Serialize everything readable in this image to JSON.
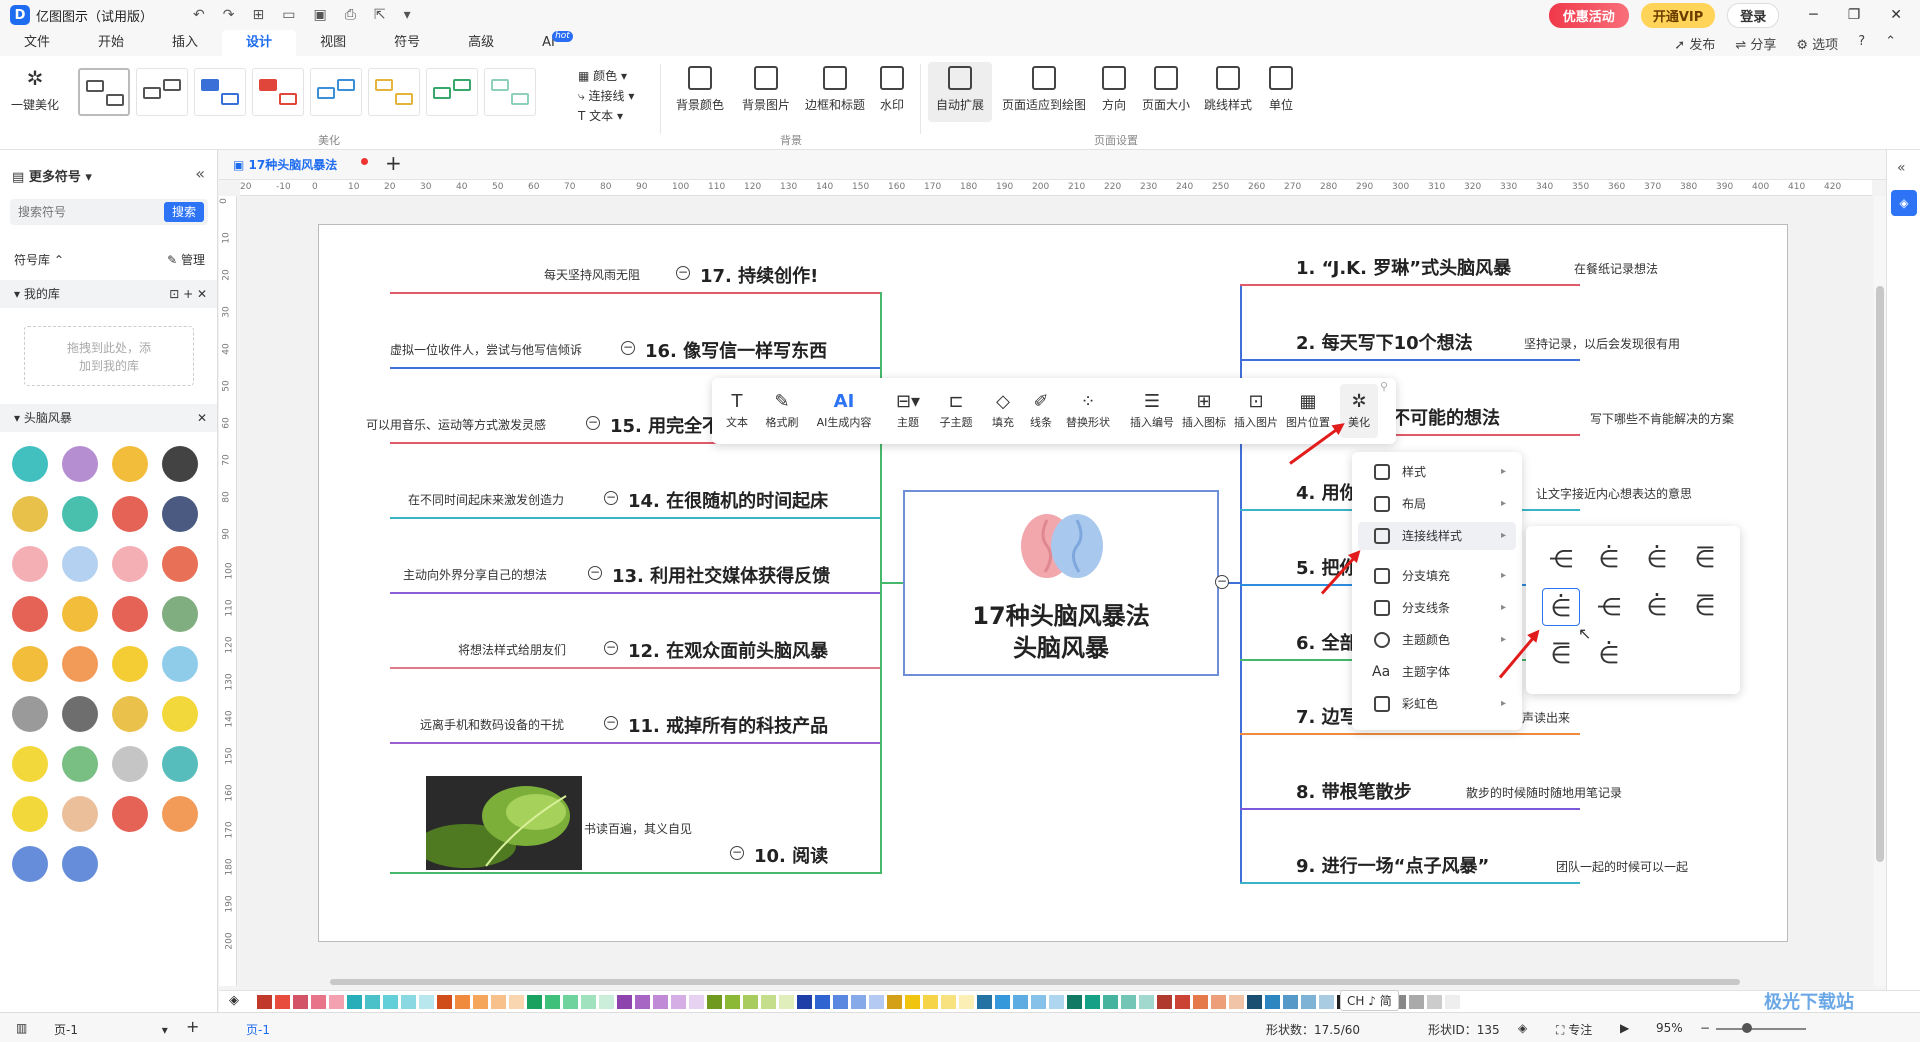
{
  "titlebar": {
    "app_title": "亿图图示（试用版）",
    "logo_letter": "D",
    "promo": "优惠活动",
    "vip": "开通VIP",
    "login": "登录"
  },
  "menubar": {
    "items": [
      "文件",
      "开始",
      "插入",
      "设计",
      "视图",
      "符号",
      "高级",
      "AI"
    ],
    "active": "设计",
    "ai_badge": "hot",
    "right": [
      "发布",
      "分享",
      "选项"
    ]
  },
  "ribbon": {
    "beautify_button": "一键美化",
    "group_beautify": "美化",
    "color_option": "颜色",
    "connector_option": "连接线",
    "text_option": "文本",
    "background_buttons": [
      "背景颜色",
      "背景图片",
      "边框和标题",
      "水印"
    ],
    "group_background": "背景",
    "page_buttons": [
      "自动扩展",
      "页面适应到绘图",
      "方向",
      "页面大小",
      "跳线样式",
      "单位"
    ],
    "group_page": "页面设置"
  },
  "leftpanel": {
    "title": "更多符号",
    "search_placeholder": "搜索符号",
    "search_button": "搜索",
    "library_label": "符号库",
    "manage": "管理",
    "my_library": "我的库",
    "drop_hint_1": "拖拽到此处，添",
    "drop_hint_2": "加到我的库",
    "category": "头脑风暴"
  },
  "tab": {
    "name": "17种头脑风暴法"
  },
  "ruler": {
    "h_ticks": [
      "20",
      "-10",
      "0",
      "10",
      "20",
      "30",
      "40",
      "50",
      "60",
      "70",
      "80",
      "90",
      "100",
      "110",
      "120",
      "130",
      "140",
      "150",
      "160",
      "170",
      "180",
      "190",
      "200",
      "210",
      "220",
      "230",
      "240",
      "250",
      "260",
      "270",
      "280",
      "290",
      "300",
      "310",
      "320",
      "330",
      "340",
      "350",
      "360",
      "370",
      "380",
      "390",
      "400",
      "410",
      "420"
    ],
    "v_ticks": [
      "0",
      "10",
      "20",
      "30",
      "40",
      "50",
      "60",
      "70",
      "80",
      "90",
      "100",
      "110",
      "120",
      "130",
      "140",
      "150",
      "160",
      "170",
      "180",
      "190",
      "200"
    ]
  },
  "mindmap": {
    "center_line1": "17种头脑风暴法",
    "center_line2": "头脑风暴",
    "left": [
      {
        "title": "17. 持续创作!",
        "note": "每天坚持风雨无阻",
        "color": "#e05a6b"
      },
      {
        "title": "16. 像写信一样写东西",
        "note": "虚拟一位收件人，尝试与他写信倾诉",
        "color": "#3f6fd8"
      },
      {
        "title": "15. 用完全不",
        "note": "可以用音乐、运动等方式激发灵感",
        "color": "#e05a6b"
      },
      {
        "title": "14. 在很随机的时间起床",
        "note": "在不同时间起床来激发创造力",
        "color": "#39b4c7"
      },
      {
        "title": "13. 利用社交媒体获得反馈",
        "note": "主动向外界分享自己的想法",
        "color": "#8a5ed6"
      },
      {
        "title": "12. 在观众面前头脑风暴",
        "note": "将想法样式给朋友们",
        "color": "#e07a8a"
      },
      {
        "title": "11. 戒掉所有的科技产品",
        "note": "远离手机和数码设备的干扰",
        "color": "#9b5fd0"
      },
      {
        "title": "10. 阅读",
        "note": "书读百遍，其义自见",
        "color": "#45b86b"
      }
    ],
    "right": [
      {
        "title": "1. “J.K. 罗琳”式头脑风暴",
        "note": "在餐纸记录想法",
        "color": "#e05a6b"
      },
      {
        "title": "2. 每天写下10个想法",
        "note": "坚持记录，以后会发现很有用",
        "color": "#3f6fd8"
      },
      {
        "title": "个不可能的想法",
        "note": "写下哪些不肯能解决的方案",
        "color": "#e05a6b"
      },
      {
        "title": "4. 用你",
        "note": "让文字接近内心想表达的意思",
        "color": "#39b4c7"
      },
      {
        "title": "5. 把你",
        "note": "",
        "color": "#2f8de0"
      },
      {
        "title": "6. 全部",
        "note": "",
        "color": "#45b86b"
      },
      {
        "title": "7. 边写",
        "note": "声读出来",
        "color": "#f08a3c"
      },
      {
        "title": "8. 带根笔散步",
        "note": "散步的时候随时随地用笔记录",
        "color": "#7a5ad8"
      },
      {
        "title": "9. 进行一场“点子风暴”",
        "note": "团队一起的时候可以一起",
        "color": "#39b4c7"
      }
    ]
  },
  "floatbar": {
    "buttons": [
      "文本",
      "格式刷",
      "AI生成内容",
      "主题",
      "子主题",
      "填充",
      "线条",
      "替换形状",
      "插入编号",
      "插入图标",
      "插入图片",
      "图片位置",
      "美化"
    ],
    "ai_glyph": "AI"
  },
  "ctxmenu": {
    "items": [
      "样式",
      "布局",
      "连接线样式",
      "分支填充",
      "分支线条",
      "主题颜色",
      "主题字体",
      "彩虹色"
    ],
    "font_glyph": "Aa"
  },
  "palette": {
    "colors": [
      "#c0392b",
      "#e74c3c",
      "#d35467",
      "#e8748a",
      "#f3a0b0",
      "#27aeb9",
      "#4ac0c9",
      "#63cfd9",
      "#8ad9e2",
      "#b8e8ee",
      "#d04d1a",
      "#f08a3c",
      "#f5a65b",
      "#f8c08a",
      "#fad6b0",
      "#19a15f",
      "#3ebf7a",
      "#6ed39c",
      "#9fe2bd",
      "#cbeeda",
      "#8e44ad",
      "#a866c4",
      "#c08ad6",
      "#d5aee5",
      "#e8d2f1",
      "#6f9a1f",
      "#8cb935",
      "#a9cc5e",
      "#c5de8c",
      "#e0eebc",
      "#1f3fa8",
      "#3064d1",
      "#5a88e0",
      "#86a9ea",
      "#b4caf2",
      "#d4a017",
      "#f1c40f",
      "#f5d447",
      "#f8e27f",
      "#fbefb5",
      "#2471a3",
      "#3498db",
      "#5dade2",
      "#85c1e9",
      "#aed6f1",
      "#117a65",
      "#16a085",
      "#45b39d",
      "#73c6b6",
      "#a2d9ce",
      "#b03a2e",
      "#cb4335",
      "#e6794a",
      "#ec9f78",
      "#f2c4a7",
      "#1b4f72",
      "#2e86c1",
      "#5499c7",
      "#7fb3d5",
      "#a9cce3",
      "#222222",
      "#444444",
      "#666666",
      "#888888",
      "#aaaaaa",
      "#cccccc",
      "#eeeeee"
    ]
  },
  "statusbar": {
    "page_select": "页-1",
    "page_tab": "页-1",
    "shape_count": "形状数：17.5/60",
    "shape_id": "形状ID：135",
    "focus": "专注",
    "zoom": "95%",
    "ime": "CH ♪ 简",
    "watermark": "极光下载站"
  }
}
